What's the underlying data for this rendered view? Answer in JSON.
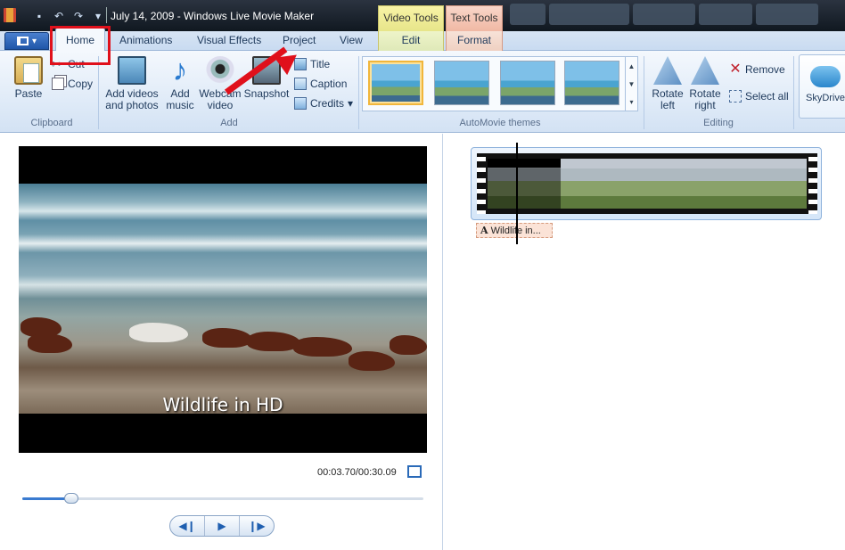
{
  "window": {
    "title": "July 14, 2009 - Windows Live Movie Maker"
  },
  "contextual_tabs": {
    "video_tools": "Video Tools",
    "text_tools": "Text Tools"
  },
  "tabs": [
    "Home",
    "Animations",
    "Visual Effects",
    "Project",
    "View",
    "Edit",
    "Format"
  ],
  "ribbon": {
    "clipboard": {
      "label": "Clipboard",
      "paste": "Paste",
      "cut": "Cut",
      "copy": "Copy"
    },
    "add": {
      "label": "Add",
      "add_videos": "Add videos and photos",
      "add_music": "Add music",
      "webcam": "Webcam video",
      "snapshot": "Snapshot",
      "title": "Title",
      "caption": "Caption",
      "credits": "Credits"
    },
    "themes": {
      "label": "AutoMovie themes"
    },
    "editing": {
      "label": "Editing",
      "rotate_left": "Rotate left",
      "rotate_right": "Rotate right",
      "remove": "Remove",
      "select_all": "Select all"
    },
    "skydrive": "SkyDrive"
  },
  "preview": {
    "caption_text": "Wildlife in HD",
    "time": "00:03.70/00:30.09",
    "progress": 0.123
  },
  "storyboard": {
    "title_clip": "Wildlife in..."
  }
}
